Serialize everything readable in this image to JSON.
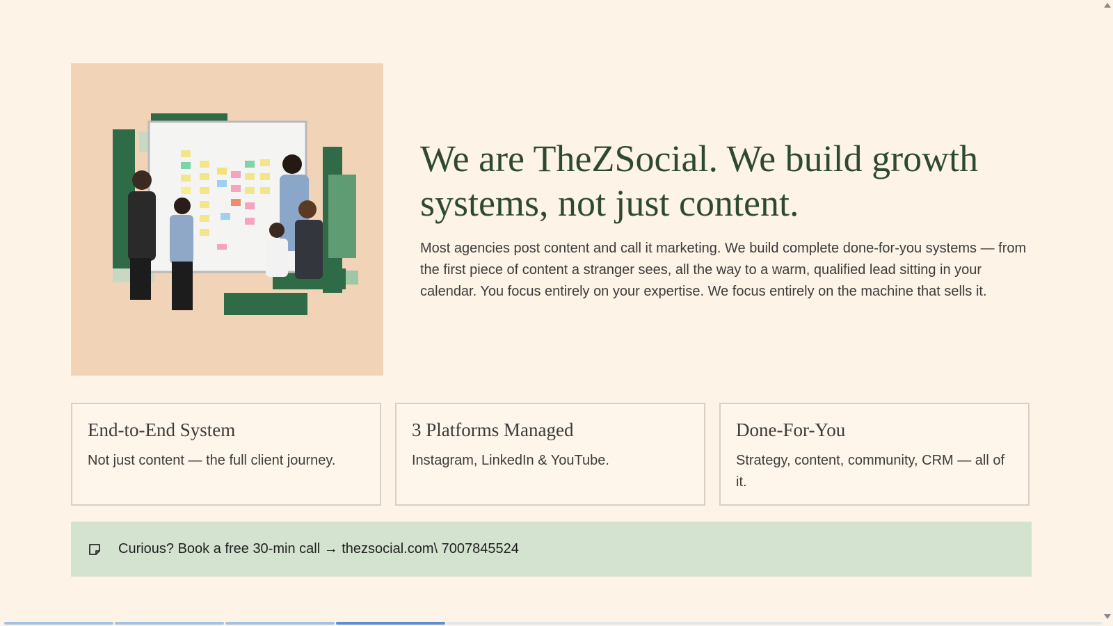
{
  "hero": {
    "image_alt": "Team planning with sticky notes on whiteboard",
    "headline": "We are TheZSocial. We build growth systems, not just content.",
    "intro": "Most agencies post content and call it marketing. We build complete done-for-you systems — from the first piece of content a stranger sees, all the way to a warm, qualified lead sitting in your calendar. You focus entirely on your expertise. We focus entirely on the machine that sells it."
  },
  "cards": [
    {
      "title": "End-to-End System",
      "desc": "Not just content — the full client journey."
    },
    {
      "title": "3 Platforms Managed",
      "desc": "Instagram, LinkedIn & YouTube."
    },
    {
      "title": "Done-For-You",
      "desc": "Strategy, content, community, CRM — all of it."
    }
  ],
  "cta": {
    "icon": "note-icon",
    "text": "Curious? Book a free 30-min call → thezsocial.com\\ 7007845524"
  },
  "progress": {
    "segments_total": 4,
    "active_index": 3,
    "colors": {
      "done": "#9fc2e6",
      "active": "#5a8fd6",
      "track": "#dfe7ef"
    }
  },
  "colors": {
    "background": "#fdf3e6",
    "headline": "#2e4a2e",
    "image_bg": "#f1d3b8",
    "cta_bg": "#d4e3cf",
    "accent_green": "#2f6b47"
  }
}
